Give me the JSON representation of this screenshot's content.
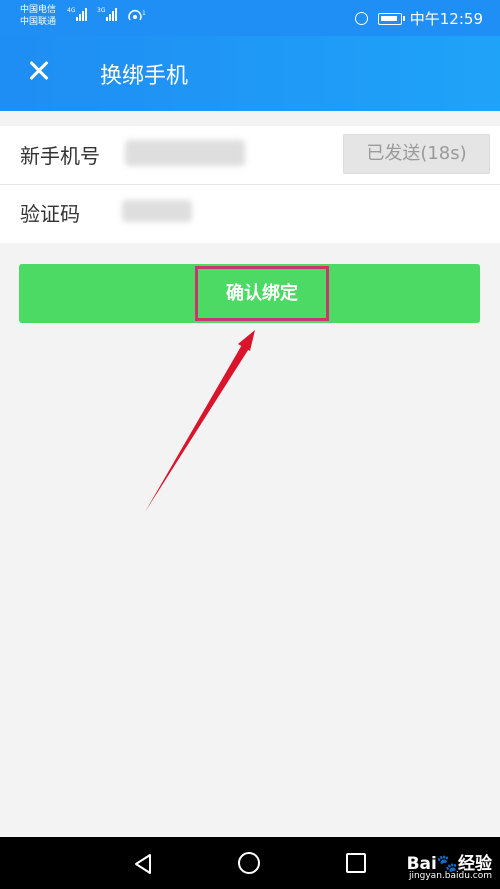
{
  "status_bar": {
    "carrier1": "中国电信",
    "carrier2": "中国联通",
    "net1": "4G",
    "net2": "3G",
    "time": "中午12:59"
  },
  "header": {
    "title": "换绑手机",
    "close_icon": "close-icon"
  },
  "form": {
    "phone_label": "新手机号",
    "code_label": "验证码",
    "send_button": "已发送(18s)"
  },
  "confirm_button": "确认绑定",
  "watermark": {
    "brand": "Bai🐾经验",
    "url": "jingyan.baidu.com"
  },
  "colors": {
    "header": "#1f8ff5",
    "confirm": "#4cd964",
    "highlight_box": "#c8366d",
    "annotation_arrow": "#d9142b"
  },
  "icons": [
    "close-icon",
    "alarm-icon",
    "battery-icon",
    "back-icon",
    "home-icon",
    "recents-icon"
  ]
}
